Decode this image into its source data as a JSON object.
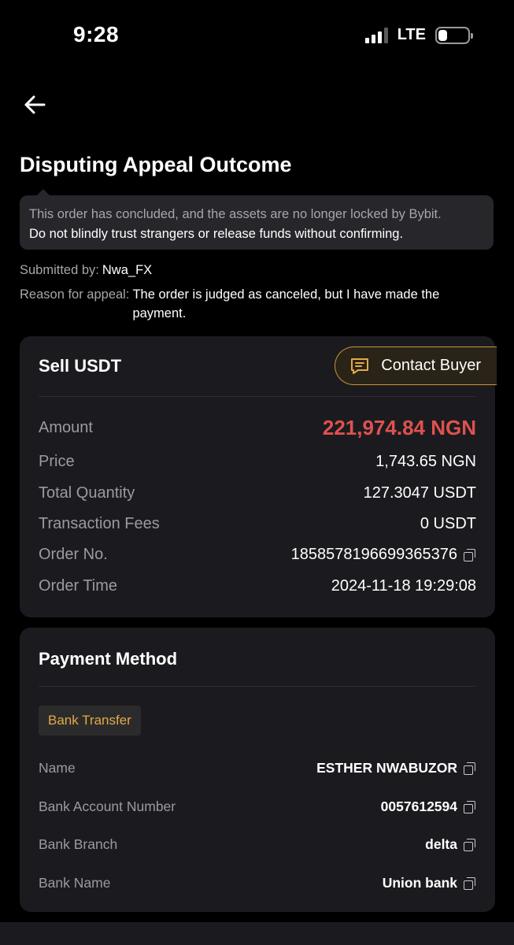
{
  "status_bar": {
    "time": "9:28",
    "network": "LTE",
    "battery_level": 0.3
  },
  "header": {
    "title": "Disputing Appeal Outcome"
  },
  "warning": {
    "line1": "This order has concluded, and the assets are no longer locked by Bybit.",
    "line2": "Do not blindly trust strangers or release funds without confirming."
  },
  "meta": {
    "submitted_label": "Submitted by:",
    "submitted_value": "Nwa_FX",
    "reason_label": "Reason for appeal:",
    "reason_value": "The order is judged as canceled, but I have made the payment."
  },
  "order": {
    "title": "Sell USDT",
    "contact_label": "Contact Buyer",
    "rows": [
      {
        "label": "Amount",
        "value": "221,974.84 NGN"
      },
      {
        "label": "Price",
        "value": "1,743.65 NGN"
      },
      {
        "label": "Total Quantity",
        "value": "127.3047 USDT"
      },
      {
        "label": "Transaction Fees",
        "value": "0 USDT"
      },
      {
        "label": "Order No.",
        "value": "1858578196699365376"
      },
      {
        "label": "Order Time",
        "value": "2024-11-18 19:29:08"
      }
    ]
  },
  "payment": {
    "title": "Payment Method",
    "method": "Bank Transfer",
    "rows": [
      {
        "label": "Name",
        "value": "ESTHER NWABUZOR"
      },
      {
        "label": "Bank Account Number",
        "value": "0057612594"
      },
      {
        "label": "Bank Branch",
        "value": "delta"
      },
      {
        "label": "Bank Name",
        "value": "Union bank"
      }
    ]
  },
  "colors": {
    "accent": "#e3a94a",
    "amount": "#e0514f",
    "card": "#1b1b1f",
    "background": "#000000"
  }
}
